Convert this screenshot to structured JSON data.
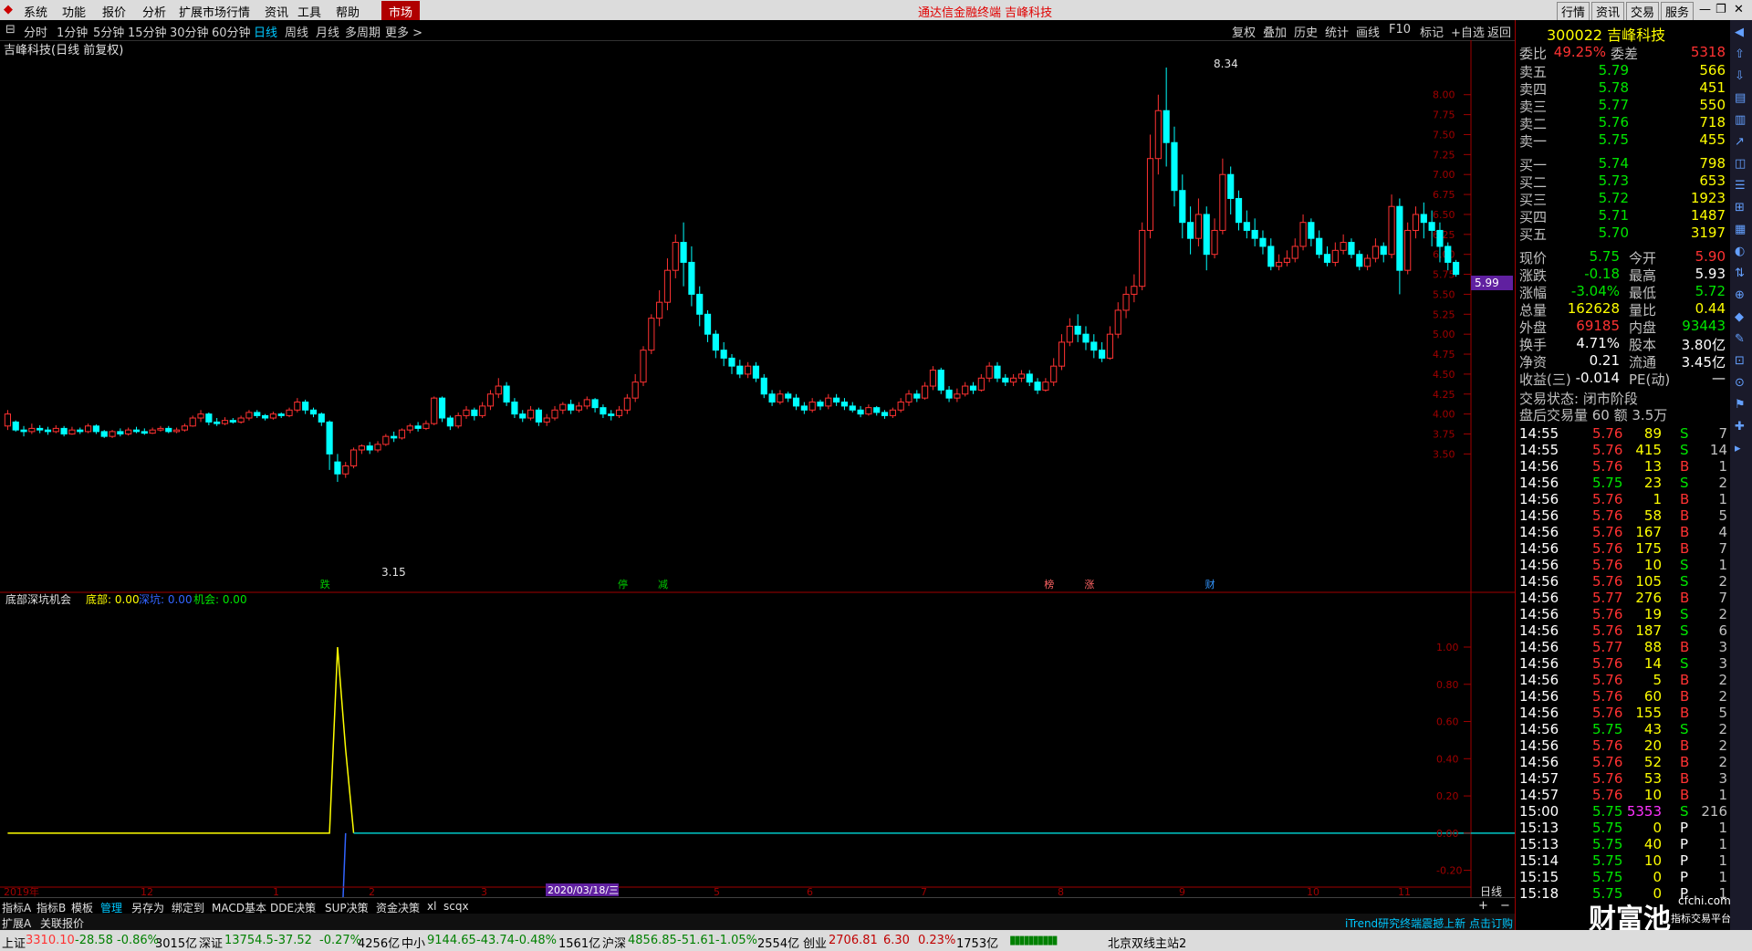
{
  "menubar": {
    "items": [
      "系统",
      "功能",
      "报价",
      "分析",
      "扩展市场行情",
      "资讯",
      "工具",
      "帮助"
    ],
    "market_tab": "市场",
    "title": "通达信金融终端  吉峰科技",
    "right_buttons": [
      "行情",
      "资讯",
      "交易",
      "服务"
    ]
  },
  "periods": [
    "分时",
    "1分钟",
    "5分钟",
    "15分钟",
    "30分钟",
    "60分钟",
    "日线",
    "周线",
    "月线",
    "多周期",
    "更多 >"
  ],
  "active_period": "日线",
  "tools": [
    "复权",
    "叠加",
    "历史",
    "统计",
    "画线",
    "F10",
    "标记",
    "+自选",
    "返回"
  ],
  "chart": {
    "stock_label": "吉峰科技(日线 前复权)",
    "y_ticks": [
      "8.00",
      "7.75",
      "7.50",
      "7.25",
      "7.00",
      "6.75",
      "6.50",
      "6.25",
      "6.00",
      "5.75",
      "5.50",
      "5.25",
      "5.00",
      "4.75",
      "4.50",
      "4.25",
      "4.00",
      "3.75",
      "3.50"
    ],
    "current_marker": "5.99",
    "high_label": "8.34",
    "low_label": "3.15",
    "event_markers": [
      "跌",
      "停",
      "减",
      "榜",
      "涨",
      "财"
    ],
    "x_labels": [
      "2019年",
      "12",
      "1",
      "2",
      "3",
      "2020/03/18/三",
      "5",
      "6",
      "7",
      "8",
      "9",
      "10",
      "11"
    ],
    "period_label": "日线"
  },
  "indicator": {
    "name": "底部深坑机会",
    "vals": [
      "底部: 0.00",
      "深坑: 0.00",
      "机会: 0.00"
    ],
    "y_ticks": [
      "1.00",
      "0.80",
      "0.60",
      "0.40",
      "0.20",
      "0.00",
      "-0.20"
    ]
  },
  "tabs1": [
    "指标A",
    "指标B",
    "模板",
    "管理",
    "另存为",
    "绑定到",
    "MACD基本",
    "DDE决策",
    "SUP决策",
    "资金决策",
    "xl",
    "scqx"
  ],
  "tabs2": [
    "扩展A",
    "关联报价"
  ],
  "news": "iTrend研究终端震撼上新 点击订购",
  "quote": {
    "code_name": "300022 吉峰科技",
    "weibi": [
      "委比",
      "49.25%",
      "委差",
      "5318"
    ],
    "asks": [
      [
        "卖五",
        "5.79",
        "566"
      ],
      [
        "卖四",
        "5.78",
        "451"
      ],
      [
        "卖三",
        "5.77",
        "550"
      ],
      [
        "卖二",
        "5.76",
        "718"
      ],
      [
        "卖一",
        "5.75",
        "455"
      ]
    ],
    "bids": [
      [
        "买一",
        "5.74",
        "798"
      ],
      [
        "买二",
        "5.73",
        "653"
      ],
      [
        "买三",
        "5.72",
        "1923"
      ],
      [
        "买四",
        "5.71",
        "1487"
      ],
      [
        "买五",
        "5.70",
        "3197"
      ]
    ],
    "stats": [
      [
        "现价",
        "5.75",
        "今开",
        "5.90"
      ],
      [
        "涨跌",
        "-0.18",
        "最高",
        "5.93"
      ],
      [
        "涨幅",
        "-3.04%",
        "最低",
        "5.72"
      ],
      [
        "总量",
        "162628",
        "量比",
        "0.44"
      ],
      [
        "外盘",
        "69185",
        "内盘",
        "93443"
      ],
      [
        "换手",
        "4.71%",
        "股本",
        "3.80亿"
      ],
      [
        "净资",
        "0.21",
        "流通",
        "3.45亿"
      ],
      [
        "收益(三)",
        "-0.014",
        "PE(动)",
        "—"
      ]
    ],
    "trade_state": "交易状态: 闭市阶段",
    "after_hours": "盘后交易量 60 额 3.5万"
  },
  "ticks": [
    [
      "14:55",
      "5.76",
      "89",
      "S",
      "7"
    ],
    [
      "14:55",
      "5.76",
      "415",
      "S",
      "14"
    ],
    [
      "14:56",
      "5.76",
      "13",
      "B",
      "1"
    ],
    [
      "14:56",
      "5.75",
      "23",
      "S",
      "2"
    ],
    [
      "14:56",
      "5.76",
      "1",
      "B",
      "1"
    ],
    [
      "14:56",
      "5.76",
      "58",
      "B",
      "5"
    ],
    [
      "14:56",
      "5.76",
      "167",
      "B",
      "4"
    ],
    [
      "14:56",
      "5.76",
      "175",
      "B",
      "7"
    ],
    [
      "14:56",
      "5.76",
      "10",
      "S",
      "1"
    ],
    [
      "14:56",
      "5.76",
      "105",
      "S",
      "2"
    ],
    [
      "14:56",
      "5.77",
      "276",
      "B",
      "7"
    ],
    [
      "14:56",
      "5.76",
      "19",
      "S",
      "2"
    ],
    [
      "14:56",
      "5.76",
      "187",
      "S",
      "6"
    ],
    [
      "14:56",
      "5.77",
      "88",
      "B",
      "3"
    ],
    [
      "14:56",
      "5.76",
      "14",
      "S",
      "3"
    ],
    [
      "14:56",
      "5.76",
      "5",
      "B",
      "2"
    ],
    [
      "14:56",
      "5.76",
      "60",
      "B",
      "2"
    ],
    [
      "14:56",
      "5.76",
      "155",
      "B",
      "5"
    ],
    [
      "14:56",
      "5.75",
      "43",
      "S",
      "2"
    ],
    [
      "14:56",
      "5.76",
      "20",
      "B",
      "2"
    ],
    [
      "14:56",
      "5.76",
      "52",
      "B",
      "2"
    ],
    [
      "14:57",
      "5.76",
      "53",
      "B",
      "3"
    ],
    [
      "14:57",
      "5.76",
      "10",
      "B",
      "1"
    ],
    [
      "15:00",
      "5.75",
      "5353",
      "S",
      "216"
    ],
    [
      "15:13",
      "5.75",
      "0",
      "P",
      "1"
    ],
    [
      "15:13",
      "5.75",
      "40",
      "P",
      "1"
    ],
    [
      "15:14",
      "5.75",
      "10",
      "P",
      "1"
    ],
    [
      "15:15",
      "5.75",
      "0",
      "P",
      "1"
    ],
    [
      "15:18",
      "5.75",
      "0",
      "P",
      "1"
    ]
  ],
  "right_strip": [
    "笔",
    "价",
    "细",
    "势",
    "联",
    "值",
    "主",
    "筹"
  ],
  "statusbar": {
    "items": [
      [
        "上证",
        "3310.10",
        "-28.58",
        "-0.86%",
        "3015亿"
      ],
      [
        "深证",
        "13754.5",
        "-37.52",
        "-0.27%",
        "4256亿"
      ],
      [
        "中小",
        "9144.65",
        "-43.74",
        "-0.48%",
        "1561亿"
      ],
      [
        "沪深",
        "4856.85",
        "-51.61",
        "-1.05%",
        "2554亿"
      ],
      [
        "创业",
        "2706.81",
        "6.30",
        "0.23%",
        "1753亿"
      ]
    ],
    "server": "北京双线主站2"
  },
  "watermark": [
    "财富池",
    "cfchi.com",
    "指标交易平台"
  ],
  "candles": [
    [
      3.85,
      4.0,
      3.8,
      4.05
    ],
    [
      3.9,
      3.8,
      3.78,
      3.92
    ],
    [
      3.8,
      3.78,
      3.72,
      3.85
    ],
    [
      3.78,
      3.82,
      3.75,
      3.88
    ],
    [
      3.82,
      3.8,
      3.76,
      3.86
    ],
    [
      3.8,
      3.78,
      3.74,
      3.84
    ],
    [
      3.78,
      3.82,
      3.76,
      3.86
    ],
    [
      3.82,
      3.75,
      3.72,
      3.85
    ],
    [
      3.75,
      3.8,
      3.74,
      3.84
    ],
    [
      3.8,
      3.78,
      3.75,
      3.83
    ],
    [
      3.78,
      3.85,
      3.76,
      3.88
    ],
    [
      3.85,
      3.78,
      3.75,
      3.87
    ],
    [
      3.78,
      3.72,
      3.7,
      3.8
    ],
    [
      3.72,
      3.78,
      3.7,
      3.8
    ],
    [
      3.78,
      3.75,
      3.72,
      3.82
    ],
    [
      3.75,
      3.8,
      3.73,
      3.83
    ],
    [
      3.8,
      3.78,
      3.76,
      3.84
    ],
    [
      3.78,
      3.76,
      3.74,
      3.82
    ],
    [
      3.76,
      3.8,
      3.75,
      3.83
    ],
    [
      3.8,
      3.82,
      3.78,
      3.85
    ],
    [
      3.82,
      3.78,
      3.76,
      3.85
    ],
    [
      3.78,
      3.8,
      3.76,
      3.83
    ],
    [
      3.8,
      3.85,
      3.78,
      3.88
    ],
    [
      3.85,
      3.95,
      3.84,
      3.98
    ],
    [
      3.95,
      4.0,
      3.9,
      4.05
    ],
    [
      4.0,
      3.9,
      3.86,
      4.02
    ],
    [
      3.9,
      3.88,
      3.85,
      3.95
    ],
    [
      3.88,
      3.92,
      3.86,
      3.96
    ],
    [
      3.92,
      3.9,
      3.88,
      3.95
    ],
    [
      3.9,
      3.95,
      3.88,
      3.98
    ],
    [
      3.95,
      4.02,
      3.92,
      4.05
    ],
    [
      4.02,
      3.98,
      3.95,
      4.05
    ],
    [
      3.98,
      3.95,
      3.92,
      4.0
    ],
    [
      3.95,
      4.0,
      3.93,
      4.03
    ],
    [
      4.0,
      3.98,
      3.95,
      4.02
    ],
    [
      3.98,
      4.05,
      3.96,
      4.08
    ],
    [
      4.05,
      4.15,
      4.02,
      4.2
    ],
    [
      4.15,
      4.05,
      4.0,
      4.18
    ],
    [
      4.05,
      4.0,
      3.96,
      4.08
    ],
    [
      4.0,
      3.9,
      3.85,
      4.02
    ],
    [
      3.9,
      3.5,
      3.3,
      3.92
    ],
    [
      3.4,
      3.25,
      3.15,
      3.5
    ],
    [
      3.25,
      3.35,
      3.2,
      3.4
    ],
    [
      3.35,
      3.55,
      3.32,
      3.58
    ],
    [
      3.55,
      3.6,
      3.5,
      3.62
    ],
    [
      3.6,
      3.55,
      3.5,
      3.65
    ],
    [
      3.55,
      3.62,
      3.52,
      3.66
    ],
    [
      3.62,
      3.72,
      3.6,
      3.75
    ],
    [
      3.72,
      3.7,
      3.65,
      3.78
    ],
    [
      3.7,
      3.8,
      3.68,
      3.82
    ],
    [
      3.8,
      3.85,
      3.76,
      3.88
    ],
    [
      3.85,
      3.82,
      3.78,
      3.9
    ],
    [
      3.82,
      3.88,
      3.8,
      3.92
    ],
    [
      3.88,
      4.2,
      3.86,
      4.22
    ],
    [
      4.2,
      3.95,
      3.9,
      4.22
    ],
    [
      3.95,
      3.85,
      3.8,
      3.98
    ],
    [
      3.85,
      3.98,
      3.82,
      4.02
    ],
    [
      3.98,
      4.05,
      3.94,
      4.1
    ],
    [
      4.05,
      3.98,
      3.92,
      4.08
    ],
    [
      3.98,
      4.1,
      3.95,
      4.15
    ],
    [
      4.1,
      4.25,
      4.05,
      4.3
    ],
    [
      4.25,
      4.35,
      4.2,
      4.45
    ],
    [
      4.35,
      4.15,
      4.1,
      4.4
    ],
    [
      4.15,
      4.0,
      3.95,
      4.2
    ],
    [
      4.0,
      3.95,
      3.9,
      4.05
    ],
    [
      3.95,
      4.05,
      3.92,
      4.1
    ],
    [
      4.05,
      3.9,
      3.85,
      4.08
    ],
    [
      3.9,
      3.95,
      3.85,
      4.0
    ],
    [
      3.95,
      4.05,
      3.92,
      4.1
    ],
    [
      4.05,
      4.12,
      4.0,
      4.15
    ],
    [
      4.12,
      4.05,
      4.0,
      4.18
    ],
    [
      4.05,
      4.1,
      4.02,
      4.15
    ],
    [
      4.1,
      4.18,
      4.06,
      4.22
    ],
    [
      4.18,
      4.08,
      4.02,
      4.2
    ],
    [
      4.08,
      4.0,
      3.95,
      4.12
    ],
    [
      4.0,
      3.98,
      3.92,
      4.05
    ],
    [
      3.98,
      4.05,
      3.95,
      4.1
    ],
    [
      4.05,
      4.2,
      4.0,
      4.25
    ],
    [
      4.2,
      4.4,
      4.15,
      4.5
    ],
    [
      4.4,
      4.8,
      4.35,
      4.85
    ],
    [
      4.8,
      5.2,
      4.75,
      5.25
    ],
    [
      5.2,
      5.4,
      5.1,
      5.55
    ],
    [
      5.4,
      5.8,
      5.3,
      5.95
    ],
    [
      5.8,
      6.15,
      5.7,
      6.25
    ],
    [
      6.15,
      5.9,
      5.6,
      6.4
    ],
    [
      5.9,
      5.5,
      5.35,
      6.1
    ],
    [
      5.5,
      5.25,
      5.1,
      5.6
    ],
    [
      5.25,
      5.0,
      4.9,
      5.3
    ],
    [
      5.0,
      4.8,
      4.7,
      5.05
    ],
    [
      4.8,
      4.7,
      4.6,
      4.9
    ],
    [
      4.7,
      4.6,
      4.5,
      4.75
    ],
    [
      4.6,
      4.5,
      4.45,
      4.68
    ],
    [
      4.5,
      4.6,
      4.45,
      4.65
    ],
    [
      4.6,
      4.45,
      4.4,
      4.65
    ],
    [
      4.45,
      4.25,
      4.2,
      4.5
    ],
    [
      4.25,
      4.15,
      4.1,
      4.3
    ],
    [
      4.15,
      4.25,
      4.12,
      4.3
    ],
    [
      4.25,
      4.2,
      4.15,
      4.28
    ],
    [
      4.2,
      4.1,
      4.05,
      4.25
    ],
    [
      4.1,
      4.05,
      4.0,
      4.15
    ],
    [
      4.05,
      4.15,
      4.02,
      4.2
    ],
    [
      4.15,
      4.1,
      4.05,
      4.18
    ],
    [
      4.1,
      4.2,
      4.06,
      4.25
    ],
    [
      4.2,
      4.15,
      4.1,
      4.25
    ],
    [
      4.15,
      4.1,
      4.05,
      4.2
    ],
    [
      4.1,
      4.05,
      4.02,
      4.15
    ],
    [
      4.05,
      4.0,
      3.96,
      4.1
    ],
    [
      4.0,
      4.08,
      3.98,
      4.12
    ],
    [
      4.08,
      4.02,
      3.98,
      4.1
    ],
    [
      4.02,
      3.98,
      3.94,
      4.05
    ],
    [
      3.98,
      4.05,
      3.95,
      4.08
    ],
    [
      4.05,
      4.15,
      4.02,
      4.2
    ],
    [
      4.15,
      4.25,
      4.1,
      4.3
    ],
    [
      4.25,
      4.2,
      4.15,
      4.3
    ],
    [
      4.2,
      4.35,
      4.18,
      4.4
    ],
    [
      4.35,
      4.55,
      4.3,
      4.6
    ],
    [
      4.55,
      4.3,
      4.25,
      4.58
    ],
    [
      4.3,
      4.2,
      4.15,
      4.35
    ],
    [
      4.2,
      4.25,
      4.15,
      4.32
    ],
    [
      4.25,
      4.35,
      4.22,
      4.4
    ],
    [
      4.35,
      4.3,
      4.25,
      4.4
    ],
    [
      4.3,
      4.45,
      4.28,
      4.5
    ],
    [
      4.45,
      4.6,
      4.4,
      4.65
    ],
    [
      4.6,
      4.45,
      4.4,
      4.65
    ],
    [
      4.45,
      4.4,
      4.35,
      4.5
    ],
    [
      4.4,
      4.45,
      4.35,
      4.5
    ],
    [
      4.45,
      4.5,
      4.4,
      4.55
    ],
    [
      4.5,
      4.4,
      4.35,
      4.55
    ],
    [
      4.4,
      4.3,
      4.25,
      4.45
    ],
    [
      4.3,
      4.4,
      4.28,
      4.45
    ],
    [
      4.4,
      4.6,
      4.35,
      4.7
    ],
    [
      4.6,
      4.9,
      4.55,
      5.0
    ],
    [
      4.9,
      5.1,
      4.85,
      5.2
    ],
    [
      5.1,
      5.0,
      4.9,
      5.25
    ],
    [
      5.0,
      4.9,
      4.8,
      5.1
    ],
    [
      4.9,
      4.8,
      4.7,
      5.0
    ],
    [
      4.8,
      4.7,
      4.65,
      4.9
    ],
    [
      4.7,
      5.0,
      4.68,
      5.1
    ],
    [
      5.0,
      5.3,
      4.95,
      5.4
    ],
    [
      5.3,
      5.5,
      5.2,
      5.6
    ],
    [
      5.5,
      5.6,
      5.4,
      5.75
    ],
    [
      5.6,
      6.3,
      5.55,
      6.4
    ],
    [
      6.3,
      7.2,
      6.2,
      7.5
    ],
    [
      7.2,
      7.8,
      7.0,
      8.0
    ],
    [
      7.8,
      7.4,
      7.1,
      8.34
    ],
    [
      7.4,
      6.8,
      6.6,
      7.6
    ],
    [
      6.8,
      6.4,
      6.2,
      7.0
    ],
    [
      6.4,
      6.2,
      6.0,
      6.6
    ],
    [
      6.2,
      6.5,
      6.1,
      6.7
    ],
    [
      6.5,
      6.0,
      5.8,
      6.6
    ],
    [
      6.0,
      6.3,
      5.95,
      6.45
    ],
    [
      6.3,
      7.0,
      6.25,
      7.2
    ],
    [
      7.0,
      6.7,
      6.5,
      7.1
    ],
    [
      6.7,
      6.4,
      6.3,
      6.8
    ],
    [
      6.4,
      6.3,
      6.2,
      6.55
    ],
    [
      6.3,
      6.2,
      6.1,
      6.45
    ],
    [
      6.2,
      6.1,
      6.0,
      6.3
    ],
    [
      6.1,
      5.85,
      5.8,
      6.2
    ],
    [
      5.85,
      5.9,
      5.8,
      6.0
    ],
    [
      5.9,
      5.95,
      5.85,
      6.05
    ],
    [
      5.95,
      6.1,
      5.9,
      6.2
    ],
    [
      6.1,
      6.4,
      6.05,
      6.5
    ],
    [
      6.4,
      6.2,
      6.1,
      6.45
    ],
    [
      6.2,
      6.0,
      5.95,
      6.3
    ],
    [
      6.0,
      5.9,
      5.85,
      6.1
    ],
    [
      5.9,
      6.05,
      5.85,
      6.15
    ],
    [
      6.05,
      6.15,
      6.0,
      6.25
    ],
    [
      6.15,
      6.0,
      5.95,
      6.2
    ],
    [
      6.0,
      5.85,
      5.8,
      6.05
    ],
    [
      5.85,
      5.95,
      5.8,
      6.0
    ],
    [
      5.95,
      6.1,
      5.9,
      6.2
    ],
    [
      6.1,
      6.0,
      5.9,
      6.15
    ],
    [
      6.0,
      6.6,
      5.95,
      6.75
    ],
    [
      6.6,
      5.8,
      5.5,
      6.7
    ],
    [
      5.8,
      6.3,
      5.75,
      6.4
    ],
    [
      6.3,
      6.5,
      6.2,
      6.6
    ],
    [
      6.5,
      6.4,
      6.2,
      6.65
    ],
    [
      6.4,
      6.3,
      6.1,
      6.55
    ],
    [
      6.3,
      6.1,
      5.9,
      6.4
    ],
    [
      6.1,
      5.9,
      5.8,
      6.15
    ],
    [
      5.9,
      5.75,
      5.72,
      5.93
    ]
  ],
  "indicator_series": [
    0,
    0,
    0,
    0,
    0,
    0,
    0,
    0,
    0,
    0,
    0,
    0,
    0,
    0,
    0,
    0,
    0,
    0,
    0,
    0,
    0,
    0,
    0,
    0,
    0,
    0,
    0,
    0,
    0,
    0,
    0,
    0,
    0,
    0,
    0,
    0,
    0,
    0,
    0,
    0,
    0,
    1.0,
    0.45,
    0,
    0,
    0,
    0,
    0,
    0,
    0,
    0,
    0,
    0,
    0,
    0,
    0,
    0,
    0,
    0,
    0,
    0,
    0,
    0,
    0,
    0,
    0,
    0,
    0,
    0,
    0,
    0,
    0,
    0,
    0,
    0,
    0,
    0,
    0,
    0,
    0,
    0,
    0,
    0,
    0,
    0,
    0,
    0,
    0,
    0,
    0,
    0,
    0,
    0,
    0,
    0,
    0,
    0,
    0,
    0,
    0,
    0,
    0,
    0,
    0,
    0,
    0,
    0,
    0,
    0,
    0,
    0,
    0,
    0,
    0,
    0,
    0,
    0,
    0,
    0,
    0,
    0,
    0,
    0,
    0,
    0,
    0,
    0,
    0,
    0,
    0,
    0,
    0,
    0,
    0,
    0,
    0,
    0,
    0,
    0,
    0,
    0,
    0,
    0,
    0,
    0,
    0,
    0,
    0,
    0,
    0,
    0,
    0,
    0,
    0,
    0,
    0,
    0,
    0,
    0,
    0,
    0,
    0,
    0,
    0,
    0,
    0,
    0,
    0,
    0,
    0,
    0,
    0,
    0,
    0,
    0,
    0,
    0,
    0,
    0,
    0,
    0,
    0,
    0,
    0,
    0,
    0,
    0,
    0,
    0,
    0,
    0
  ]
}
